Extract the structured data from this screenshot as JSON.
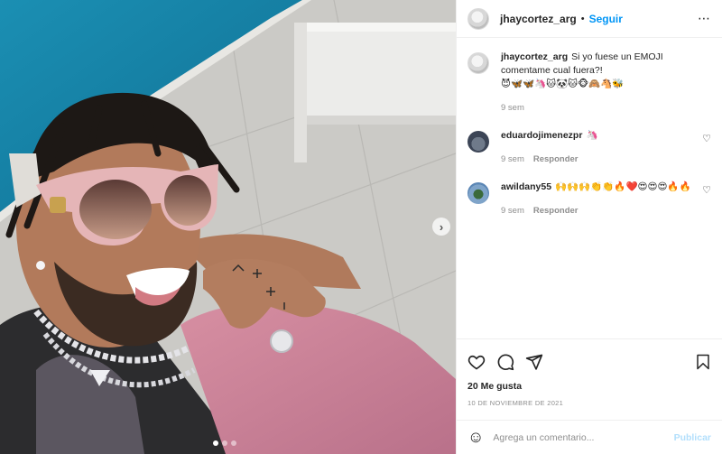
{
  "header": {
    "username": "jhaycortez_arg",
    "separator": "•",
    "follow_label": "Seguir",
    "more_glyph": "⋯"
  },
  "caption": {
    "username": "jhaycortez_arg",
    "text": "Si yo fuese un EMOJI comentame cual fuera?!",
    "emojis": "😈🦋🦋🦄🐱🐼🐱🐵🙈🐴🐝",
    "time": "9 sem"
  },
  "comments": [
    {
      "username": "eduardojimenezpr",
      "text": "🦄",
      "time": "9 sem",
      "reply_label": "Responder"
    },
    {
      "username": "awildany55",
      "text": "🙌🙌🙌👏👏🔥❤️😍😍😍🔥🔥",
      "time": "9 sem",
      "reply_label": "Responder"
    }
  ],
  "actions": {
    "likes": "20 Me gusta",
    "date": "10 DE NOVIEMBRE DE 2021"
  },
  "composer": {
    "placeholder": "Agrega un comentario...",
    "publish_label": "Publicar"
  },
  "photo": {
    "next_glyph": "›",
    "slide_count": 3,
    "active_slide": 1
  },
  "colors": {
    "follow": "#0095f6",
    "publish_disabled": "#b2dffc",
    "secondary_text": "#8e8e8e"
  }
}
